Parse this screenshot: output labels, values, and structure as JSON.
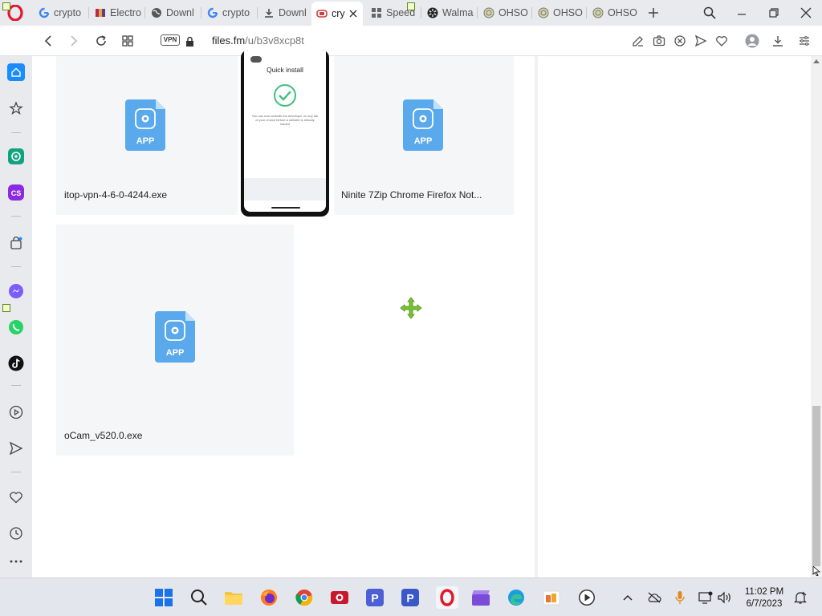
{
  "browser": {
    "tabs": [
      {
        "label": "crypto",
        "icon": "google-g-icon"
      },
      {
        "label": "Electro",
        "icon": "store-icon"
      },
      {
        "label": "Downl",
        "icon": "globe-icon"
      },
      {
        "label": "crypto",
        "icon": "google-g-icon"
      },
      {
        "label": "Downl",
        "icon": "download-icon"
      },
      {
        "label": "cry",
        "icon": "files-fm-icon",
        "active": true
      },
      {
        "label": "Speed",
        "icon": "speed-dial-icon"
      },
      {
        "label": "Walma",
        "icon": "walmart-icon"
      },
      {
        "label": "OHSO",
        "icon": "ohso-icon"
      },
      {
        "label": "OHSO",
        "icon": "ohso-icon"
      },
      {
        "label": "OHSO",
        "icon": "ohso-icon"
      }
    ],
    "vpn_label": "VPN",
    "url_host": "files.fm",
    "url_path": "/u/b3v8xcp8t"
  },
  "page": {
    "files": [
      {
        "name": "itop-vpn-4-6-0-4244.exe",
        "badge": "APP"
      },
      {
        "name": "Ninite 7Zip Chrome Firefox Not...",
        "badge": "APP"
      },
      {
        "name": "oCam_v520.0.exe",
        "badge": "APP"
      }
    ],
    "phone_overlay": {
      "title": "Quick install",
      "text": "You can now activate the developer on any tab of your choice before a website is already loaded"
    }
  },
  "taskbar": {
    "time": "11:02 PM",
    "date": "6/7/2023"
  },
  "colors": {
    "accent_red": "#e2182c",
    "file_icon_blue": "#4ea3e8",
    "handle_green": "#7ac231"
  }
}
